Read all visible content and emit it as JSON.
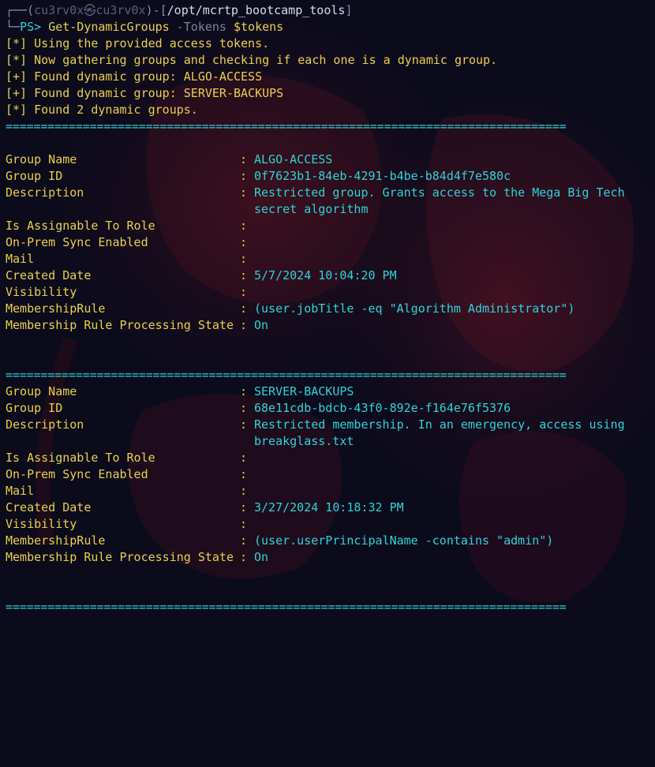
{
  "prompt": {
    "corner_top": "┌──(",
    "user": "cu3rv0x㉿cu3rv0x",
    "mid": ")-[",
    "path": "/opt/mcrtp_bootcamp_tools",
    "end": "]",
    "corner_bottom": "└─",
    "ps": "PS>",
    "command": "Get-DynamicGroups",
    "param": "-Tokens",
    "variable": "$tokens"
  },
  "messages": [
    "[*] Using the provided access tokens.",
    "[*] Now gathering groups and checking if each one is a dynamic group.",
    "[+] Found dynamic group: ALGO-ACCESS",
    "[+] Found dynamic group: SERVER-BACKUPS",
    "[*] Found 2 dynamic groups."
  ],
  "separator": "================================================================================",
  "colon": ":",
  "groups": [
    {
      "rows": [
        {
          "label": "Group Name",
          "value": "ALGO-ACCESS"
        },
        {
          "label": "Group ID",
          "value": "0f7623b1-84eb-4291-b4be-b84d4f7e580c"
        },
        {
          "label": "Description",
          "value": "Restricted group. Grants access to the Mega Big Tech",
          "cont": "secret algorithm"
        },
        {
          "label": "Is Assignable To Role",
          "value": ""
        },
        {
          "label": "On-Prem Sync Enabled",
          "value": ""
        },
        {
          "label": "Mail",
          "value": ""
        },
        {
          "label": "Created Date",
          "value": "5/7/2024 10:04:20 PM"
        },
        {
          "label": "Visibility",
          "value": ""
        },
        {
          "label": "MembershipRule",
          "value": "(user.jobTitle -eq \"Algorithm Administrator\")"
        },
        {
          "label": "Membership Rule Processing State",
          "value": "On"
        }
      ]
    },
    {
      "rows": [
        {
          "label": "Group Name",
          "value": "SERVER-BACKUPS"
        },
        {
          "label": "Group ID",
          "value": "68e11cdb-bdcb-43f0-892e-f164e76f5376"
        },
        {
          "label": "Description",
          "value": "Restricted membership. In an emergency, access using",
          "cont": "breakglass.txt"
        },
        {
          "label": "Is Assignable To Role",
          "value": ""
        },
        {
          "label": "On-Prem Sync Enabled",
          "value": ""
        },
        {
          "label": "Mail",
          "value": ""
        },
        {
          "label": "Created Date",
          "value": "3/27/2024 10:18:32 PM"
        },
        {
          "label": "Visibility",
          "value": ""
        },
        {
          "label": "MembershipRule",
          "value": "(user.userPrincipalName -contains \"admin\")"
        },
        {
          "label": "Membership Rule Processing State",
          "value": "On"
        }
      ]
    }
  ],
  "colors": {
    "background": "#0c0b1c",
    "yellow": "#e8d04a",
    "cyan": "#2ed3d8",
    "wallpaper_red": "#6a1526"
  }
}
